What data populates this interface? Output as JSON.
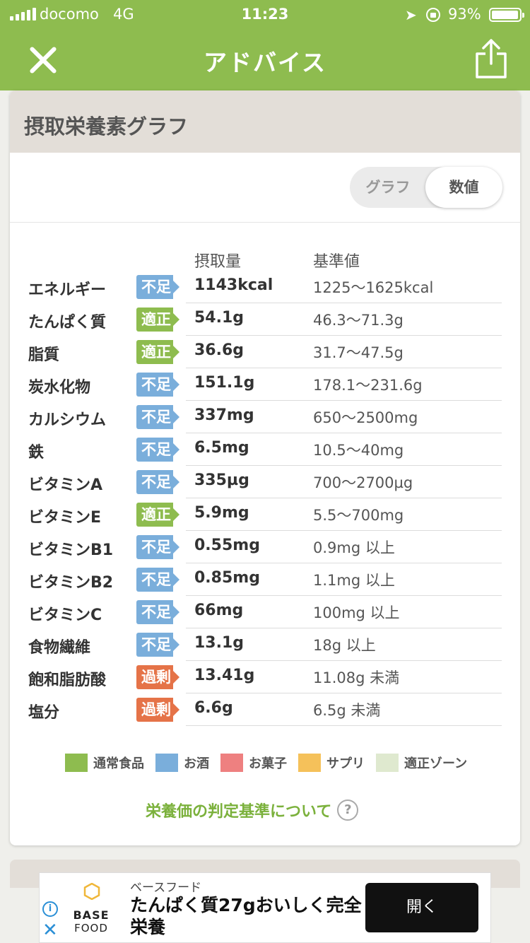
{
  "status_bar": {
    "carrier": "docomo",
    "network": "4G",
    "time": "11:23",
    "location_icon": "➤",
    "battery_percent": "93%"
  },
  "nav": {
    "title": "アドバイス"
  },
  "card": {
    "title": "摂取栄養素グラフ",
    "toggle": {
      "graph": "グラフ",
      "value": "数値",
      "selected": "数値"
    },
    "col_intake": "摂取量",
    "col_standard": "基準値",
    "rows": [
      {
        "name": "エネルギー",
        "status": "不足",
        "level": "low",
        "intake": "1143kcal",
        "standard": "1225〜1625kcal"
      },
      {
        "name": "たんぱく質",
        "status": "適正",
        "level": "ok",
        "intake": "54.1g",
        "standard": "46.3〜71.3g"
      },
      {
        "name": "脂質",
        "status": "適正",
        "level": "ok",
        "intake": "36.6g",
        "standard": "31.7〜47.5g"
      },
      {
        "name": "炭水化物",
        "status": "不足",
        "level": "low",
        "intake": "151.1g",
        "standard": "178.1〜231.6g"
      },
      {
        "name": "カルシウム",
        "status": "不足",
        "level": "low",
        "intake": "337mg",
        "standard": "650〜2500mg"
      },
      {
        "name": "鉄",
        "status": "不足",
        "level": "low",
        "intake": "6.5mg",
        "standard": "10.5〜40mg"
      },
      {
        "name": "ビタミンA",
        "status": "不足",
        "level": "low",
        "intake": "335µg",
        "standard": "700〜2700µg"
      },
      {
        "name": "ビタミンE",
        "status": "適正",
        "level": "ok",
        "intake": "5.9mg",
        "standard": "5.5〜700mg"
      },
      {
        "name": "ビタミンB1",
        "status": "不足",
        "level": "low",
        "intake": "0.55mg",
        "standard": "0.9mg 以上"
      },
      {
        "name": "ビタミンB2",
        "status": "不足",
        "level": "low",
        "intake": "0.85mg",
        "standard": "1.1mg 以上"
      },
      {
        "name": "ビタミンC",
        "status": "不足",
        "level": "low",
        "intake": "66mg",
        "standard": "100mg 以上"
      },
      {
        "name": "食物繊維",
        "status": "不足",
        "level": "low",
        "intake": "13.1g",
        "standard": "18g 以上"
      },
      {
        "name": "飽和脂肪酸",
        "status": "過剰",
        "level": "high",
        "intake": "13.41g",
        "standard": "11.08g 未満"
      },
      {
        "name": "塩分",
        "status": "過剰",
        "level": "high",
        "intake": "6.6g",
        "standard": "6.5g 未満"
      }
    ],
    "legend": [
      {
        "label": "通常食品",
        "color": "#8ebc4f"
      },
      {
        "label": "お酒",
        "color": "#7aaedb"
      },
      {
        "label": "お菓子",
        "color": "#ee8080"
      },
      {
        "label": "サプリ",
        "color": "#f5c15a"
      },
      {
        "label": "適正ゾーン",
        "color": "#dfe9cf"
      }
    ],
    "criteria_link": "栄養価の判定基準について",
    "help_icon": "?"
  },
  "ad": {
    "advertiser": "ベースフード",
    "logo_text_1": "BASE",
    "logo_text_2": "FOOD",
    "headline": "たんぱく質27gおいしく完全栄養",
    "cta": "開く",
    "info_icon": "i",
    "close_icon": "✕"
  },
  "colors": {
    "brand_green": "#8ebc4f",
    "status_ok": "#8ebc4f",
    "status_low": "#7aaedb",
    "status_high": "#e57348",
    "link_green": "#7bb13c"
  }
}
